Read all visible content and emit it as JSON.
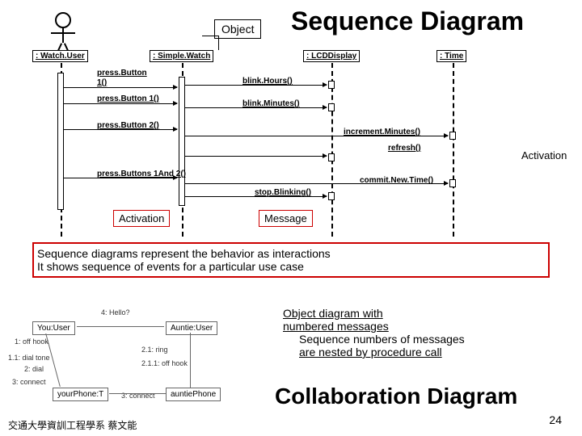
{
  "titles": {
    "main": "Sequence Diagram",
    "collab": "Collaboration Diagram"
  },
  "labels": {
    "object": "Object",
    "activation_left": "Activation",
    "activation_right": "Activation",
    "message": "Message"
  },
  "lifelines": {
    "actor": ": Watch.User",
    "simple": ": Simple.Watch",
    "lcd": ": LCDDisplay",
    "time": ": Time"
  },
  "messages": {
    "m1a": "press.Button",
    "m1b": "1()",
    "m2": "press.Button 1()",
    "m3": "press.Button 2()",
    "m4": "press.Buttons 1And 2()",
    "r1": "blink.Hours()",
    "r2": "blink.Minutes()",
    "r3": "increment.Minutes()",
    "r4": "refresh()",
    "r5": "commit.New.Time()",
    "r6": "stop.Blinking()"
  },
  "description": {
    "line1": "Sequence diagrams represent the behavior as interactions",
    "line2": "It shows sequence of events for a particular use case"
  },
  "side_text": {
    "line1": "Object diagram with",
    "line2": "numbered messages",
    "line3": "Sequence numbers of  messages",
    "line4": "are nested by procedure call"
  },
  "collab": {
    "you": "You:User",
    "auntie": "Auntie:User",
    "yphone": "yourPhone:T",
    "aphone": "auntiePhone",
    "m1": "1: off hook",
    "m11": "1.1: dial tone",
    "m2": "2: dial",
    "m3": "3: connect",
    "m4": "4: Hello?",
    "m21": "2.1: ring",
    "m211": "2.1.1: off hook",
    "m3b": "3: connect"
  },
  "footer": "交通大學資訓工程學系 蔡文能",
  "page": "24"
}
